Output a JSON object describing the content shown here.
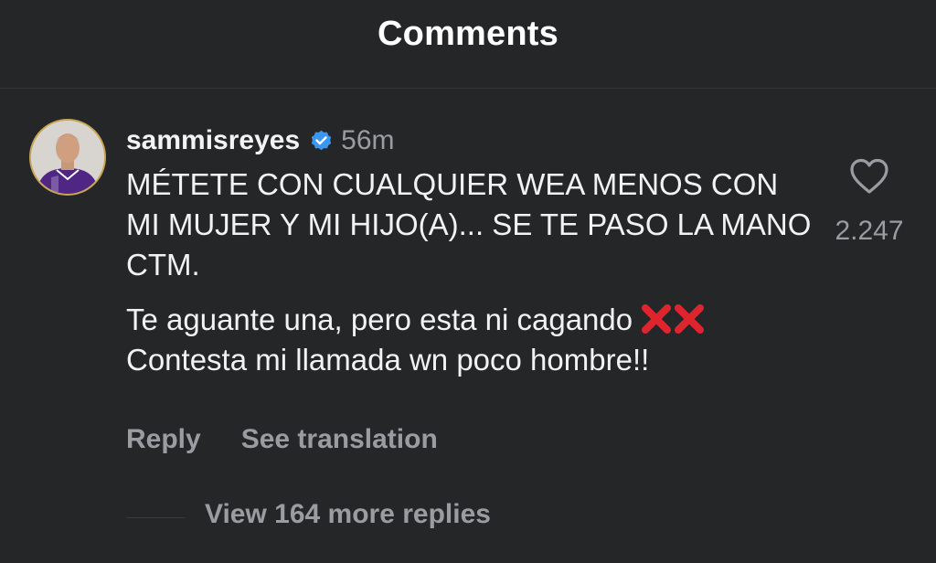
{
  "header": {
    "title": "Comments"
  },
  "comment": {
    "username": "sammisreyes",
    "verified": true,
    "verified_icon": "verified-badge-icon",
    "verified_color": "#3897f0",
    "timestamp": "56m",
    "text_line1": "MÉTETE CON CUALQUIER WEA MENOS CON MI MUJER Y MI HIJO(A)... SE TE PASO LA MANO CTM.",
    "text_line2_a": "Te aguante una, pero esta ni cagando",
    "text_line2_emoji": "cross-mark-icon",
    "text_line2_b": "Contesta mi llamada wn poco hombre!!",
    "like_icon": "heart-outline-icon",
    "like_count": "2.247"
  },
  "actions": {
    "reply_label": "Reply",
    "translate_label": "See translation"
  },
  "replies": {
    "view_more_label": "View 164 more replies"
  },
  "colors": {
    "background": "#252628",
    "primary_text": "#f2f2f2",
    "secondary_text": "#9a9ca1",
    "accent_red": "#e0242e"
  }
}
